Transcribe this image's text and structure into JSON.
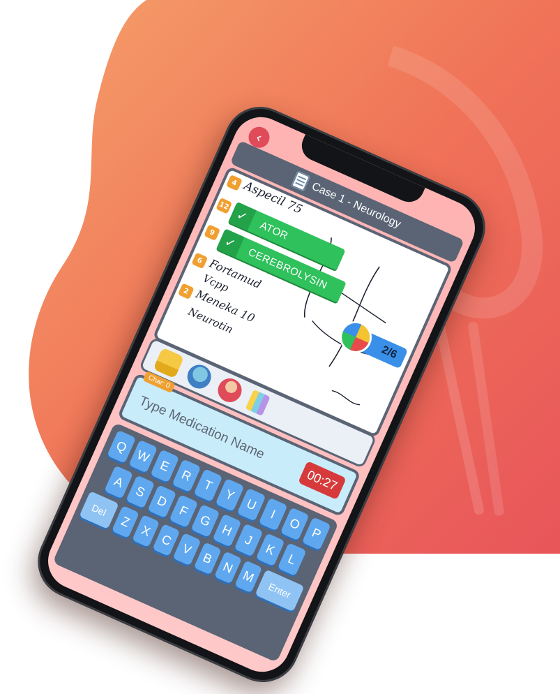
{
  "colors": {
    "background_gradient": [
      "#f5a06a",
      "#f07358",
      "#e8555a"
    ],
    "accent_green": "#2fc15b",
    "timer_red": "#d73a3a",
    "frame": "#5a6475"
  },
  "header": {
    "title": "Case 1 - Neurology",
    "case_icon": "clipboard-icon"
  },
  "back_button": {
    "icon": "chevron-left-icon",
    "glyph": "‹"
  },
  "prescription": {
    "handwritten_lines": [
      "Aspecil 75",
      "Fortamud",
      "Vcpp",
      "Meneka 10",
      "Neurotin"
    ],
    "line_markers": [
      "4",
      "12",
      "9",
      "6",
      "2"
    ],
    "found_medications": [
      {
        "label": "ATOR",
        "icon": "check-icon"
      },
      {
        "label": "CEREBROLYSIN",
        "icon": "check-icon"
      }
    ],
    "progress": {
      "text": "2/6",
      "icon": "pie-progress-icon"
    }
  },
  "hints": [
    "folder-icon",
    "people-question-icon",
    "doctor-icon",
    "pills-icon"
  ],
  "input": {
    "char_count_label": "Char: 0",
    "placeholder": "Type Medication Name",
    "timer": "00:27"
  },
  "keyboard": {
    "rows": [
      [
        "Q",
        "W",
        "E",
        "R",
        "T",
        "Y",
        "U",
        "I",
        "O",
        "P"
      ],
      [
        "A",
        "S",
        "D",
        "F",
        "G",
        "H",
        "J",
        "K",
        "L"
      ],
      [
        "Z",
        "X",
        "C",
        "V",
        "B",
        "N",
        "M"
      ]
    ],
    "delete_label": "Del",
    "enter_label": "Enter"
  }
}
